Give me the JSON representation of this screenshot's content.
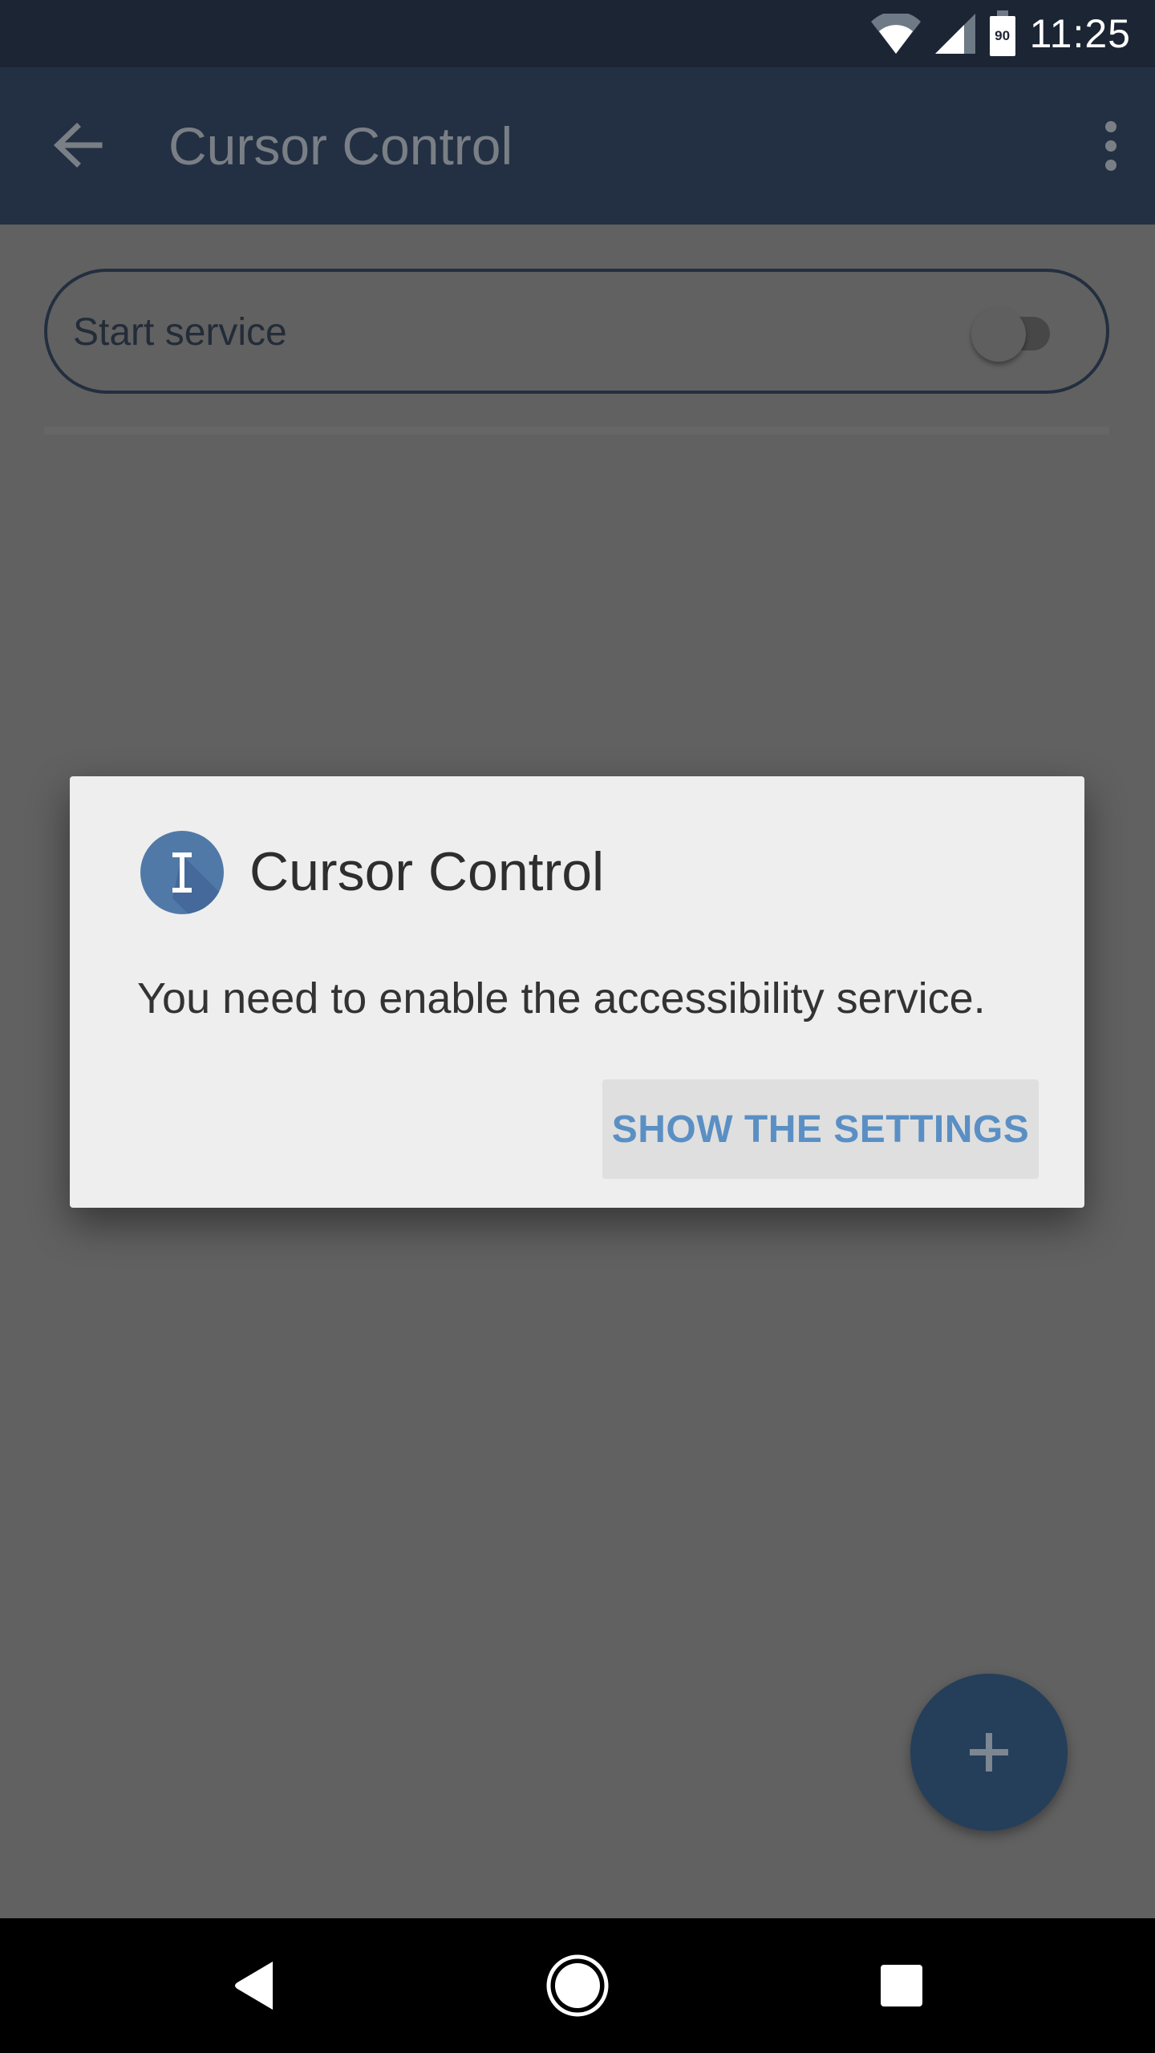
{
  "status_bar": {
    "time": "11:25",
    "battery_level": "90",
    "icons": [
      "wifi-icon",
      "cell-signal-icon",
      "battery-icon"
    ]
  },
  "app_bar": {
    "title": "Cursor Control",
    "icons": [
      "back-arrow-icon",
      "overflow-menu-icon"
    ]
  },
  "content": {
    "service_toggle": {
      "label": "Start service",
      "enabled": false
    },
    "fab": {
      "icon": "plus-icon"
    }
  },
  "dialog": {
    "icon": "text-cursor-icon",
    "title": "Cursor Control",
    "message": "You need to enable the accessibility service.",
    "button_label": "SHOW THE SETTINGS"
  },
  "nav_bar": {
    "icons": [
      "back-nav-icon",
      "home-nav-icon",
      "recents-nav-icon"
    ]
  },
  "colors": {
    "status_bar": "#1c2533",
    "app_bar": "#233043",
    "dialog_icon": "#5079a7",
    "button_text": "#5a8fc4",
    "fab": "#253f5a"
  }
}
